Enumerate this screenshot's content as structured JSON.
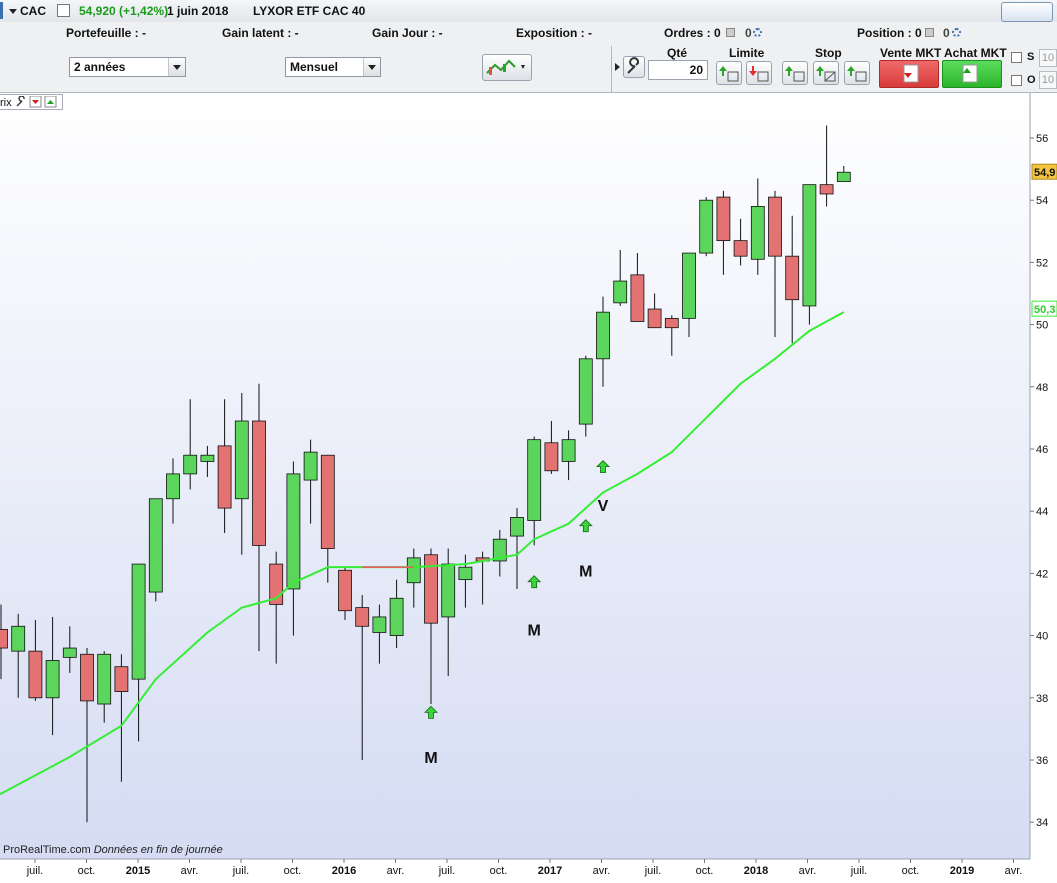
{
  "topbar": {
    "symbol": "CAC",
    "quote": "54,920 (+1,42%)",
    "date": "1 juin 2018",
    "instrument": "LYXOR ETF CAC 40"
  },
  "infobar": {
    "portefeuille": "Portefeuille : -",
    "gain_latent": "Gain latent : -",
    "gain_jour": "Gain Jour : -",
    "exposition": "Exposition : -",
    "ordres": "Ordres : 0",
    "ordres_b": "0",
    "position": "Position : 0",
    "position_b": "0"
  },
  "controls": {
    "period": "2 années",
    "interval": "Mensuel",
    "qte_label": "Qté",
    "qte_value": "20",
    "limite": "Limite",
    "stop": "Stop",
    "vente": "Vente MKT",
    "achat": "Achat MKT",
    "s_label": "S",
    "o_label": "O",
    "s_value": "10",
    "o_value": "10"
  },
  "chart_legend": "rix",
  "footer": {
    "source": "ProRealTime.com",
    "note": "Données en fin de journée"
  },
  "colors": {
    "up": "#5cd55c",
    "down": "#e37373",
    "ma": "#33ee33",
    "ma_below": "#e86060",
    "bg_top": "#ffffff",
    "bg_bottom": "#d5dcf3"
  },
  "chart_data": {
    "type": "candlestick",
    "interval": "monthly",
    "ylim": [
      33,
      57
    ],
    "y_ticks": [
      34,
      36,
      38,
      40,
      42,
      44,
      46,
      48,
      50,
      52,
      54,
      56
    ],
    "price_label": "54,9",
    "ma_label": "50,3",
    "x_ticks": [
      "juil.",
      "oct.",
      "2015",
      "avr.",
      "juil.",
      "oct.",
      "2016",
      "avr.",
      "juil.",
      "oct.",
      "2017",
      "avr.",
      "juil.",
      "oct.",
      "2018",
      "avr.",
      "juil.",
      "oct.",
      "2019",
      "avr."
    ],
    "candles": [
      {
        "o": 40.2,
        "h": 41.0,
        "l": 38.6,
        "c": 39.6
      },
      {
        "o": 39.5,
        "h": 40.7,
        "l": 38.0,
        "c": 40.3
      },
      {
        "o": 39.5,
        "h": 40.5,
        "l": 37.9,
        "c": 38.0
      },
      {
        "o": 38.0,
        "h": 40.6,
        "l": 36.8,
        "c": 39.2
      },
      {
        "o": 39.3,
        "h": 40.3,
        "l": 38.8,
        "c": 39.6
      },
      {
        "o": 39.4,
        "h": 39.6,
        "l": 34.0,
        "c": 37.9
      },
      {
        "o": 37.8,
        "h": 39.5,
        "l": 37.2,
        "c": 39.4
      },
      {
        "o": 39.0,
        "h": 39.4,
        "l": 35.3,
        "c": 38.2
      },
      {
        "o": 38.6,
        "h": 41.6,
        "l": 36.6,
        "c": 42.3
      },
      {
        "o": 41.4,
        "h": 44.4,
        "l": 41.1,
        "c": 44.4
      },
      {
        "o": 44.4,
        "h": 45.7,
        "l": 43.6,
        "c": 45.2
      },
      {
        "o": 45.2,
        "h": 47.6,
        "l": 44.7,
        "c": 45.8
      },
      {
        "o": 45.6,
        "h": 46.1,
        "l": 45.1,
        "c": 45.8
      },
      {
        "o": 46.1,
        "h": 47.6,
        "l": 43.3,
        "c": 44.1
      },
      {
        "o": 44.4,
        "h": 47.8,
        "l": 42.6,
        "c": 46.9
      },
      {
        "o": 46.9,
        "h": 48.1,
        "l": 39.5,
        "c": 42.9
      },
      {
        "o": 42.3,
        "h": 42.7,
        "l": 39.1,
        "c": 41.0
      },
      {
        "o": 41.5,
        "h": 45.6,
        "l": 40.0,
        "c": 45.2
      },
      {
        "o": 45.0,
        "h": 46.3,
        "l": 43.6,
        "c": 45.9
      },
      {
        "o": 45.8,
        "h": 45.8,
        "l": 41.7,
        "c": 42.8
      },
      {
        "o": 42.1,
        "h": 42.2,
        "l": 40.5,
        "c": 40.8
      },
      {
        "o": 40.9,
        "h": 41.3,
        "l": 36.0,
        "c": 40.3
      },
      {
        "o": 40.1,
        "h": 41.0,
        "l": 39.1,
        "c": 40.6
      },
      {
        "o": 40.0,
        "h": 41.8,
        "l": 39.6,
        "c": 41.2
      },
      {
        "o": 41.7,
        "h": 42.8,
        "l": 40.9,
        "c": 42.5
      },
      {
        "o": 42.6,
        "h": 42.8,
        "l": 37.8,
        "c": 40.4
      },
      {
        "o": 40.6,
        "h": 42.8,
        "l": 38.7,
        "c": 42.3
      },
      {
        "o": 41.8,
        "h": 42.6,
        "l": 40.9,
        "c": 42.2
      },
      {
        "o": 42.5,
        "h": 42.7,
        "l": 41.0,
        "c": 42.4
      },
      {
        "o": 42.4,
        "h": 43.4,
        "l": 41.9,
        "c": 43.1
      },
      {
        "o": 43.2,
        "h": 44.1,
        "l": 41.5,
        "c": 43.8
      },
      {
        "o": 43.7,
        "h": 46.4,
        "l": 42.9,
        "c": 46.3
      },
      {
        "o": 46.2,
        "h": 46.9,
        "l": 45.2,
        "c": 45.3
      },
      {
        "o": 45.6,
        "h": 46.6,
        "l": 45.0,
        "c": 46.3
      },
      {
        "o": 46.8,
        "h": 49.0,
        "l": 46.4,
        "c": 48.9
      },
      {
        "o": 48.9,
        "h": 50.9,
        "l": 48.0,
        "c": 50.4
      },
      {
        "o": 50.7,
        "h": 52.4,
        "l": 50.6,
        "c": 51.4
      },
      {
        "o": 51.6,
        "h": 52.3,
        "l": 50.2,
        "c": 50.1
      },
      {
        "o": 50.5,
        "h": 51.0,
        "l": 49.9,
        "c": 49.9
      },
      {
        "o": 50.2,
        "h": 50.3,
        "l": 49.0,
        "c": 49.9
      },
      {
        "o": 50.2,
        "h": 52.3,
        "l": 49.6,
        "c": 52.3
      },
      {
        "o": 52.3,
        "h": 54.1,
        "l": 52.2,
        "c": 54.0
      },
      {
        "o": 54.1,
        "h": 54.3,
        "l": 51.6,
        "c": 52.7
      },
      {
        "o": 52.7,
        "h": 53.4,
        "l": 51.9,
        "c": 52.2
      },
      {
        "o": 52.1,
        "h": 54.7,
        "l": 51.6,
        "c": 53.8
      },
      {
        "o": 54.1,
        "h": 54.3,
        "l": 49.6,
        "c": 52.2
      },
      {
        "o": 52.2,
        "h": 53.5,
        "l": 49.4,
        "c": 50.8
      },
      {
        "o": 50.6,
        "h": 54.5,
        "l": 50.0,
        "c": 54.5
      },
      {
        "o": 54.5,
        "h": 56.4,
        "l": 53.8,
        "c": 54.2
      },
      {
        "o": 54.6,
        "h": 55.1,
        "l": 54.6,
        "c": 54.9
      }
    ],
    "ma": [
      {
        "i": 0,
        "v": 34.9
      },
      {
        "i": 4,
        "v": 36.1
      },
      {
        "i": 7,
        "v": 37.1
      },
      {
        "i": 9,
        "v": 38.6
      },
      {
        "i": 12,
        "v": 40.1
      },
      {
        "i": 14,
        "v": 40.9
      },
      {
        "i": 16,
        "v": 41.2
      },
      {
        "i": 17,
        "v": 41.7
      },
      {
        "i": 19,
        "v": 42.2
      },
      {
        "i": 21,
        "v": 42.2
      },
      {
        "i": 24,
        "v": 42.2
      },
      {
        "i": 27,
        "v": 42.3
      },
      {
        "i": 30,
        "v": 42.6
      },
      {
        "i": 31,
        "v": 43.1
      },
      {
        "i": 33,
        "v": 43.6
      },
      {
        "i": 35,
        "v": 44.6
      },
      {
        "i": 37,
        "v": 45.2
      },
      {
        "i": 39,
        "v": 45.9
      },
      {
        "i": 41,
        "v": 47.0
      },
      {
        "i": 43,
        "v": 48.1
      },
      {
        "i": 45,
        "v": 48.9
      },
      {
        "i": 47,
        "v": 49.8
      },
      {
        "i": 49,
        "v": 50.4
      }
    ],
    "ma_below_range": [
      20,
      26
    ],
    "signals": [
      {
        "i": 25,
        "label": "M",
        "arrow_y": 37.5,
        "label_y": 35.9
      },
      {
        "i": 31,
        "label": "M",
        "arrow_y": 41.7,
        "label_y": 40.0
      },
      {
        "i": 34,
        "label": "M",
        "arrow_y": 43.5,
        "label_y": 41.9
      },
      {
        "i": 35,
        "label": "V",
        "arrow_y": 45.4,
        "label_y": 44.0
      }
    ]
  }
}
